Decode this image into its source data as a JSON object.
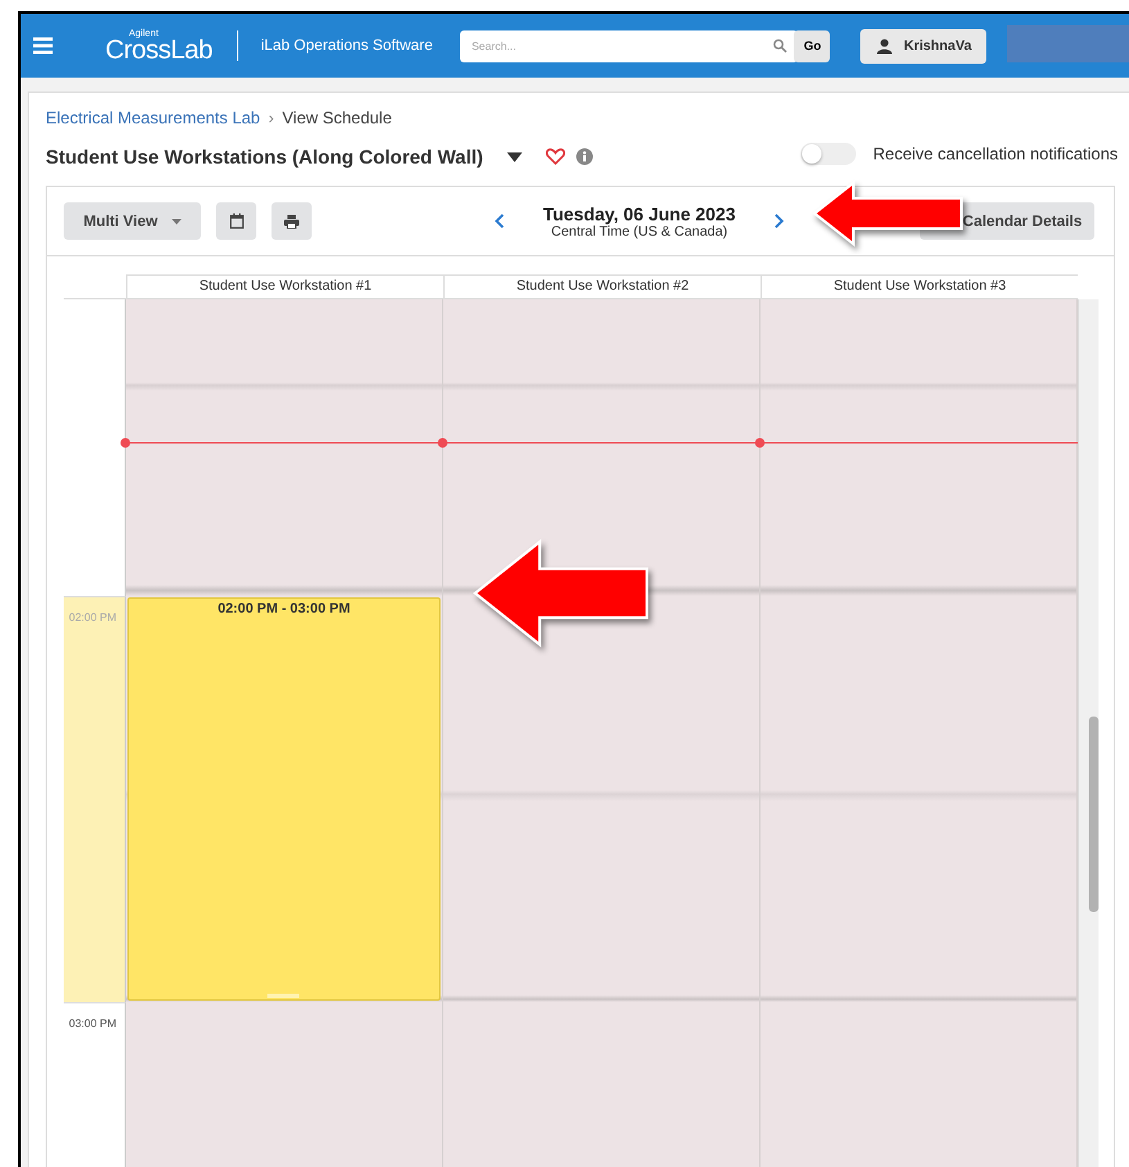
{
  "header": {
    "logo_small": "Agilent",
    "logo": "CrossLab",
    "app_name": "iLab Operations Software",
    "search": {
      "placeholder": "Search..."
    },
    "go": "Go",
    "user": "KrishnaVa"
  },
  "breadcrumb": [
    {
      "label": "Electrical Measurements Lab",
      "kind": "link"
    },
    {
      "label": "›",
      "kind": "separator"
    },
    {
      "label": "View Schedule",
      "kind": "current"
    }
  ],
  "title": "Student Use Workstations (Along Colored Wall)",
  "favorite": false,
  "notifications": {
    "label": "Receive cancellation notifications",
    "on": false
  },
  "toolbar": {
    "view": "Multi View",
    "date": "Tuesday, 06 June 2023",
    "timezone": "Central Time (US & Canada)",
    "details": "Calendar Details"
  },
  "columns": [
    "Student Use Workstation #1",
    "Student Use Workstation #2",
    "Student Use Workstation #3"
  ],
  "hours": [
    {
      "label": "02:00 PM",
      "highlighted": true,
      "slots": [
        {
          "booked": true,
          "time": "02:00 PM - 03:00 PM"
        },
        {
          "booked": false
        },
        {
          "booked": false
        }
      ]
    },
    {
      "label": "03:00 PM",
      "highlighted": false,
      "slots": [
        {
          "booked": false
        },
        {
          "booked": false
        },
        {
          "booked": false
        }
      ]
    }
  ]
}
